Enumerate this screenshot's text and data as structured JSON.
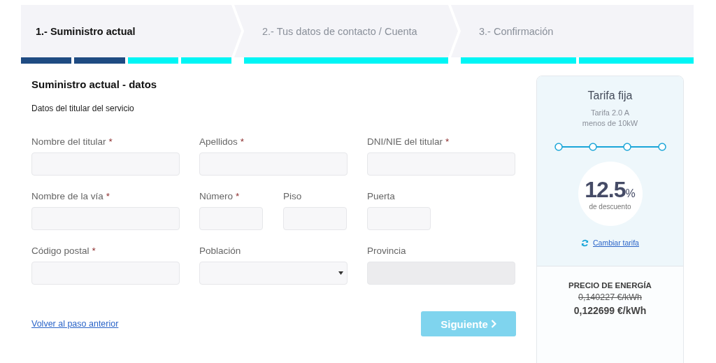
{
  "steps": [
    {
      "label": "1.- Suministro actual",
      "selected": true,
      "progress": [
        {
          "done": true
        },
        {
          "done": true
        },
        {
          "done": false
        },
        {
          "done": false
        }
      ]
    },
    {
      "label": "2.- Tus datos de contacto / Cuenta",
      "selected": false,
      "progress": [
        {
          "done": false
        }
      ]
    },
    {
      "label": "3.- Confirmación",
      "selected": false,
      "progress": [
        {
          "done": false
        },
        {
          "done": false
        }
      ]
    }
  ],
  "form": {
    "title": "Suministro actual - datos",
    "subtitle": "Datos del titular del servicio",
    "rows": [
      [
        {
          "label": "Nombre del titular",
          "required_mark": "*",
          "kind": "text"
        },
        {
          "label": "Apellidos",
          "required_mark": "*",
          "kind": "text"
        },
        {
          "label": "DNI/NIE del titular",
          "required_mark": "*",
          "kind": "text"
        }
      ],
      [
        {
          "label": "Nombre de la vía",
          "required_mark": "*",
          "kind": "text"
        },
        {
          "label": "Número",
          "required_mark": "*",
          "kind": "text"
        },
        {
          "label": "Piso",
          "kind": "text"
        },
        {
          "label": "Puerta",
          "kind": "text"
        }
      ],
      [
        {
          "label": "Código postal",
          "required_mark": "*",
          "kind": "text"
        },
        {
          "label": "Población",
          "kind": "select"
        },
        {
          "label": "Provincia",
          "kind": "disabled"
        }
      ]
    ],
    "back_link": "Volver al paso anterior",
    "next_button": {
      "label": "Siguiente",
      "disabled": true
    }
  },
  "tariff": {
    "title": "Tarifa fija",
    "subtitle_lines": [
      "Tarifa 2.0 A",
      "menos de 10kW"
    ],
    "discount_value": "12.5",
    "discount_unit": "%",
    "discount_label": "de descuento",
    "change_link": "Cambiar tarifa",
    "price_heading": "PRECIO DE ENERGÍA",
    "old_price": "0,140227 €/kWh",
    "new_price": "0,122699 €/kWh"
  }
}
